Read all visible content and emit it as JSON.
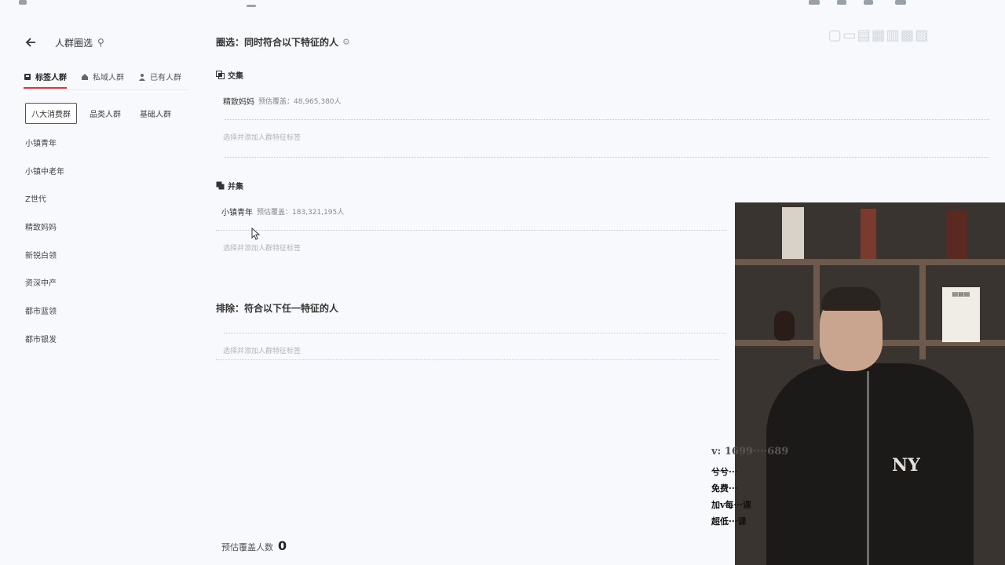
{
  "header": {
    "title": "人群圈选",
    "back_icon": "arrow-left-icon",
    "pin_icon": "pin-icon"
  },
  "tabs": [
    {
      "label": "标签人群",
      "icon": "tag-icon",
      "active": true
    },
    {
      "label": "私域人群",
      "icon": "house-icon",
      "active": false
    },
    {
      "label": "已有人群",
      "icon": "person-icon",
      "active": false
    }
  ],
  "subtabs": [
    {
      "label": "八大消费群",
      "active": true
    },
    {
      "label": "品类人群",
      "active": false
    },
    {
      "label": "基础人群",
      "active": false
    }
  ],
  "segments": [
    "小镇青年",
    "小镇中老年",
    "Z世代",
    "精致妈妈",
    "新锐白领",
    "资深中产",
    "都市蓝领",
    "都市银发"
  ],
  "main": {
    "include_title": "圈选：同时符合以下特征的人",
    "intersection": {
      "label": "交集",
      "tag_name": "精致妈妈",
      "tag_count": "预估覆盖：48,965,380人",
      "add_hint": "选择并添加人群特征标签"
    },
    "union": {
      "label": "并集",
      "tag_name": "小镇青年",
      "tag_count": "预估覆盖：183,321,195人",
      "add_hint": "选择并添加人群特征标签"
    },
    "exclude_title": "排除：符合以下任一特征的人",
    "exclude_hint": "选择并添加人群特征标签"
  },
  "footer": {
    "label": "预估覆盖人数",
    "value": "0"
  },
  "overlay": {
    "contact": "v: 1699····689",
    "lines": [
      "兮兮···",
      "免费···",
      "加v每···课",
      "超低···课"
    ]
  },
  "colors": {
    "accent": "#d63c3c",
    "background": "#f7f9fc"
  }
}
